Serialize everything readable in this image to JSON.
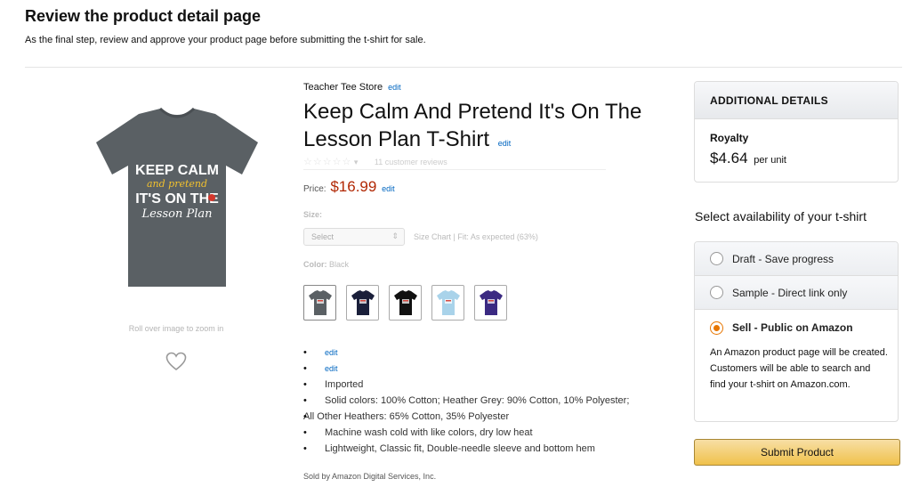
{
  "header": {
    "title": "Review the product detail page",
    "subtitle": "As the final step, review and approve your product page before submitting the t-shirt for sale."
  },
  "product": {
    "store": "Teacher Tee Store",
    "edit_label": "edit",
    "title": "Keep Calm And Pretend It's On The Lesson Plan T-Shirt",
    "image_text_line1": "KEEP CALM",
    "image_text_line2": "and pretend",
    "image_text_line3": "IT'S ON THE",
    "image_text_line4": "Lesson Plan",
    "shirt_color": "#5a6064",
    "zoom_hint": "Roll over image to zoom in",
    "rating_count": "11 customer reviews",
    "price_label": "Price:",
    "price": "$16.99",
    "size_label": "Size:",
    "size_selected": "Select",
    "size_chart": "Size Chart | Fit: As expected (63%)",
    "color_label": "Color:",
    "color_value": "Black",
    "swatches": [
      {
        "name": "heather-grey",
        "color": "#5a6064"
      },
      {
        "name": "navy",
        "color": "#1a1f3a"
      },
      {
        "name": "black",
        "color": "#111111"
      },
      {
        "name": "light-blue",
        "color": "#a9d3ea"
      },
      {
        "name": "purple",
        "color": "#3b2a82"
      }
    ],
    "bullets": {
      "b1": "edit",
      "b2": "edit",
      "b3": "Imported",
      "b4a": "Solid colors: 100% Cotton; Heather Grey: 90% Cotton, 10% Polyester;",
      "b4b": "All Other Heathers: 65% Cotton, 35% Polyester",
      "b5": "Machine wash cold with like colors, dry low heat",
      "b6": "Lightweight, Classic fit, Double-needle sleeve and bottom hem"
    },
    "sold_by": "Sold by Amazon Digital Services, Inc."
  },
  "details": {
    "header": "ADDITIONAL DETAILS",
    "royalty_label": "Royalty",
    "royalty_value": "$4.64",
    "royalty_unit": "per unit"
  },
  "availability": {
    "title": "Select availability of your t-shirt",
    "options": [
      {
        "label": "Draft - Save progress",
        "selected": false
      },
      {
        "label": "Sample - Direct link only",
        "selected": false
      },
      {
        "label": "Sell - Public on Amazon",
        "selected": true
      }
    ],
    "sell_description": "An Amazon product page will be created. Customers will be able to search and find your t-shirt on Amazon.com."
  },
  "actions": {
    "submit_label": "Submit Product"
  },
  "colors": {
    "accent_orange": "#e77600",
    "price_red": "#b12704",
    "link_blue": "#0066c0",
    "button_yellow": "#f0c14b"
  }
}
